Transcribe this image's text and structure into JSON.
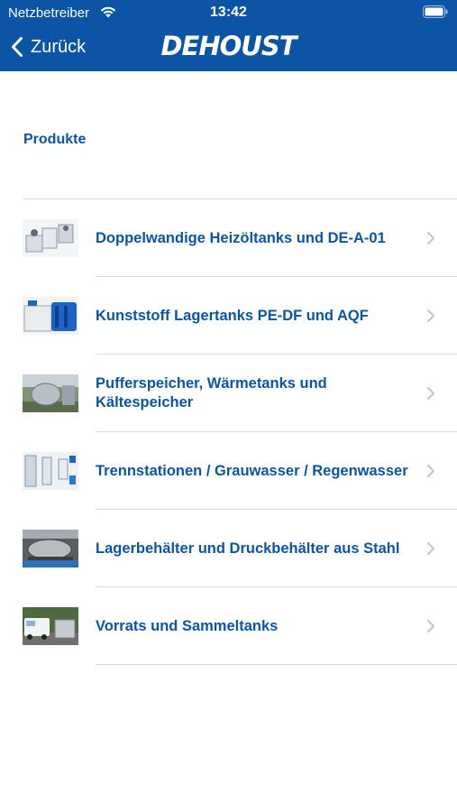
{
  "status_bar": {
    "carrier": "Netzbetreiber",
    "time": "13:42",
    "wifi_icon": "wifi-icon",
    "battery_icon": "battery-icon"
  },
  "nav": {
    "back_label": "Zurück",
    "back_icon": "chevron-left-icon",
    "logo": "DEHOUST"
  },
  "section": {
    "title": "Produkte"
  },
  "products": [
    {
      "label": "Doppelwandige Heizöltanks und DE-A-01",
      "thumbnail": "heating-oil-tanks-photo"
    },
    {
      "label": "Kunststoff Lagertanks PE-DF und AQF",
      "thumbnail": "plastic-storage-tanks-photo"
    },
    {
      "label": "Pufferspeicher, Wärmetanks und Kältespeicher",
      "thumbnail": "buffer-storage-photo"
    },
    {
      "label": "Trennstationen / Grauwasser / Regenwasser",
      "thumbnail": "separation-station-photo"
    },
    {
      "label": "Lagerbehälter und Druckbehälter aus Stahl",
      "thumbnail": "steel-tank-photo"
    },
    {
      "label": "Vorrats und Sammeltanks",
      "thumbnail": "supply-tanks-photo"
    }
  ],
  "colors": {
    "brand_blue": "#0b54a6",
    "divider": "#dcdcdc",
    "chevron": "#c4c4c7"
  }
}
